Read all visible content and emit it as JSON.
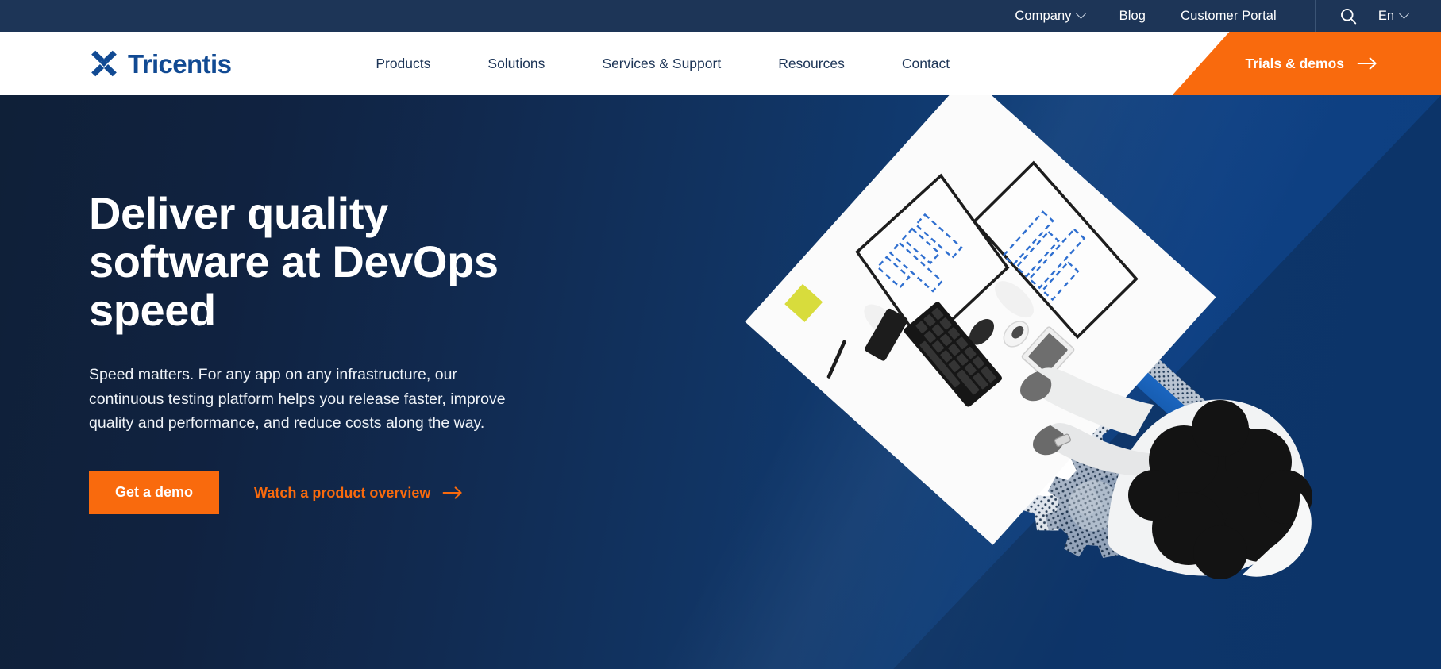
{
  "brand": {
    "name": "Tricentis",
    "logo_icon": "tricentis-x-logo-icon",
    "primary_blue": "#114a93",
    "navy": "#1d3557",
    "orange": "#f96a0d",
    "hero_dark": "#0f2038",
    "hero_blue": "#0e4083",
    "accent_yellow": "#d8dc3c"
  },
  "utility_bar": {
    "items": [
      {
        "label": "Company",
        "has_dropdown": true,
        "icon": "chevron-down-icon"
      },
      {
        "label": "Blog",
        "has_dropdown": false
      },
      {
        "label": "Customer Portal",
        "has_dropdown": false
      }
    ],
    "search_icon": "search-icon",
    "language": {
      "label": "En",
      "icon": "chevron-down-icon"
    }
  },
  "main_nav": {
    "links": [
      {
        "label": "Products"
      },
      {
        "label": "Solutions"
      },
      {
        "label": "Services & Support"
      },
      {
        "label": "Resources"
      },
      {
        "label": "Contact"
      }
    ],
    "cta": {
      "label": "Trials & demos",
      "icon": "arrow-right-icon"
    }
  },
  "hero": {
    "title": "Deliver quality software at DevOps speed",
    "subtitle": "Speed matters. For any app on any infrastructure, our continuous testing platform helps you release faster, improve quality and performance, and reduce costs along the way.",
    "primary_cta": {
      "label": "Get a demo"
    },
    "secondary_cta": {
      "label": "Watch a product overview",
      "icon": "arrow-right-icon"
    },
    "artwork": {
      "description": "Top-down photo of a person at a white desk with dual monitors, keyboard, mouse, phone and tablet, rotated as a diamond, with halftone gear graphics, dashed blue bar-chart outlines and a yellow-green diamond accent",
      "icon": "hero-desk-illustration"
    }
  }
}
